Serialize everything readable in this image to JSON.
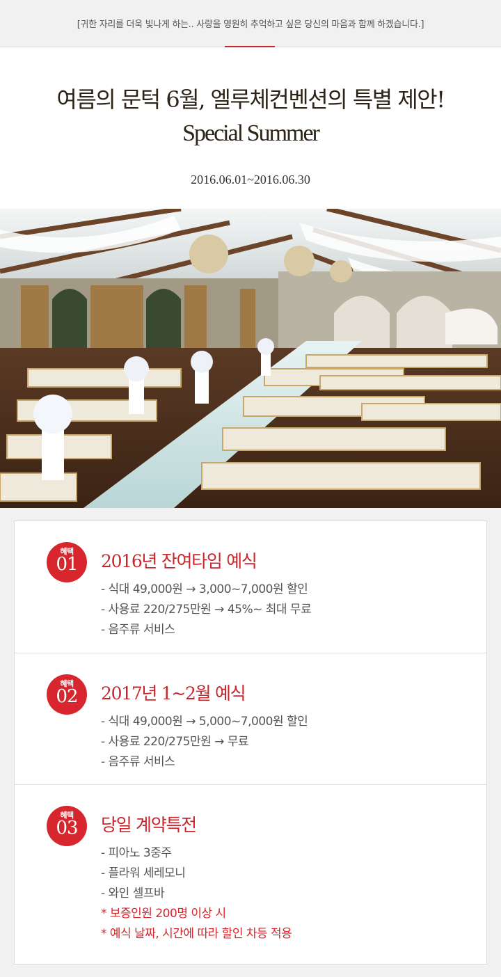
{
  "topbar": {
    "text": "[귀한 자리를 더욱 빛나게 하는.. 사랑을 영원히 추억하고 싶은 당신의 마음과 함께 하겠습니다.]"
  },
  "hero": {
    "title": "여름의 문턱 6월, 엘루체컨벤션의 특별 제안!",
    "subtitle": "Special Summer",
    "date_range": "2016.06.01~2016.06.30"
  },
  "colors": {
    "accent": "#d7262d",
    "title_brown": "#2c2417"
  },
  "benefits": [
    {
      "badge_label": "혜택",
      "badge_number": "01",
      "title": "2016년 잔여타임 예식",
      "items": [
        "- 식대 49,000원 → 3,000~7,000원 할인",
        "- 사용료 220/275만원 → 45%~ 최대 무료",
        "- 음주류 서비스"
      ]
    },
    {
      "badge_label": "혜택",
      "badge_number": "02",
      "title": "2017년 1~2월 예식",
      "items": [
        "- 식대 49,000원 → 5,000~7,000원 할인",
        "- 사용료 220/275만원 → 무료",
        "- 음주류 서비스"
      ]
    },
    {
      "badge_label": "혜택",
      "badge_number": "03",
      "title": "당일 계약특전",
      "items": [
        "- 피아노 3중주",
        "- 플라워 세레모니",
        "- 와인 셀프바"
      ],
      "notes": [
        "* 보증인원 200명 이상 시",
        "* 예식 날짜, 시간에 따라 할인 차등 적용"
      ]
    }
  ]
}
